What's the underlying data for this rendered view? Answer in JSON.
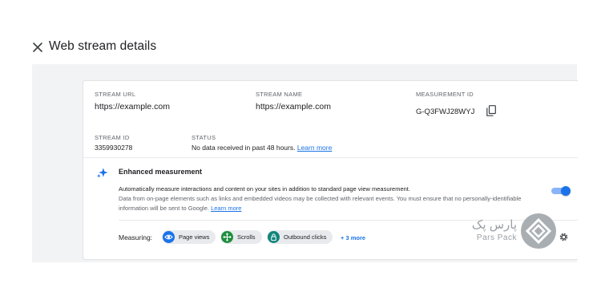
{
  "header": {
    "title": "Web stream details"
  },
  "stream": {
    "url_label": "STREAM URL",
    "url_value": "https://example.com",
    "name_label": "STREAM NAME",
    "name_value": "https://example.com",
    "measurement_label": "MEASUREMENT ID",
    "measurement_value": "G-Q3FWJ28WYJ",
    "id_label": "STREAM ID",
    "id_value": "3359930278",
    "status_label": "STATUS",
    "status_value": "No data received in past 48 hours.",
    "status_link": "Learn more"
  },
  "enhanced": {
    "title": "Enhanced measurement",
    "description": "Automatically measure interactions and content on your sites in addition to standard page view measurement.",
    "sub_description": "Data from on-page elements such as links and embedded videos may be collected with relevant events. You must ensure that no personally-identifiable information will be sent to Google.",
    "learn_more": "Learn more",
    "enabled": true,
    "measuring_label": "Measuring:",
    "chips": [
      {
        "label": "Page views",
        "icon": "eye-icon",
        "color": "#1a73e8"
      },
      {
        "label": "Scrolls",
        "icon": "move-icon",
        "color": "#1e8e3e"
      },
      {
        "label": "Outbound clicks",
        "icon": "lock-icon",
        "color": "#12857a"
      }
    ],
    "more": "+ 3 more"
  },
  "watermark": {
    "text_fa": "پارس پک",
    "text_en": "Pars Pack"
  },
  "colors": {
    "accent": "#1a73e8",
    "panel_bg": "#f1f3f4",
    "chip_bg": "#e8eaed"
  }
}
